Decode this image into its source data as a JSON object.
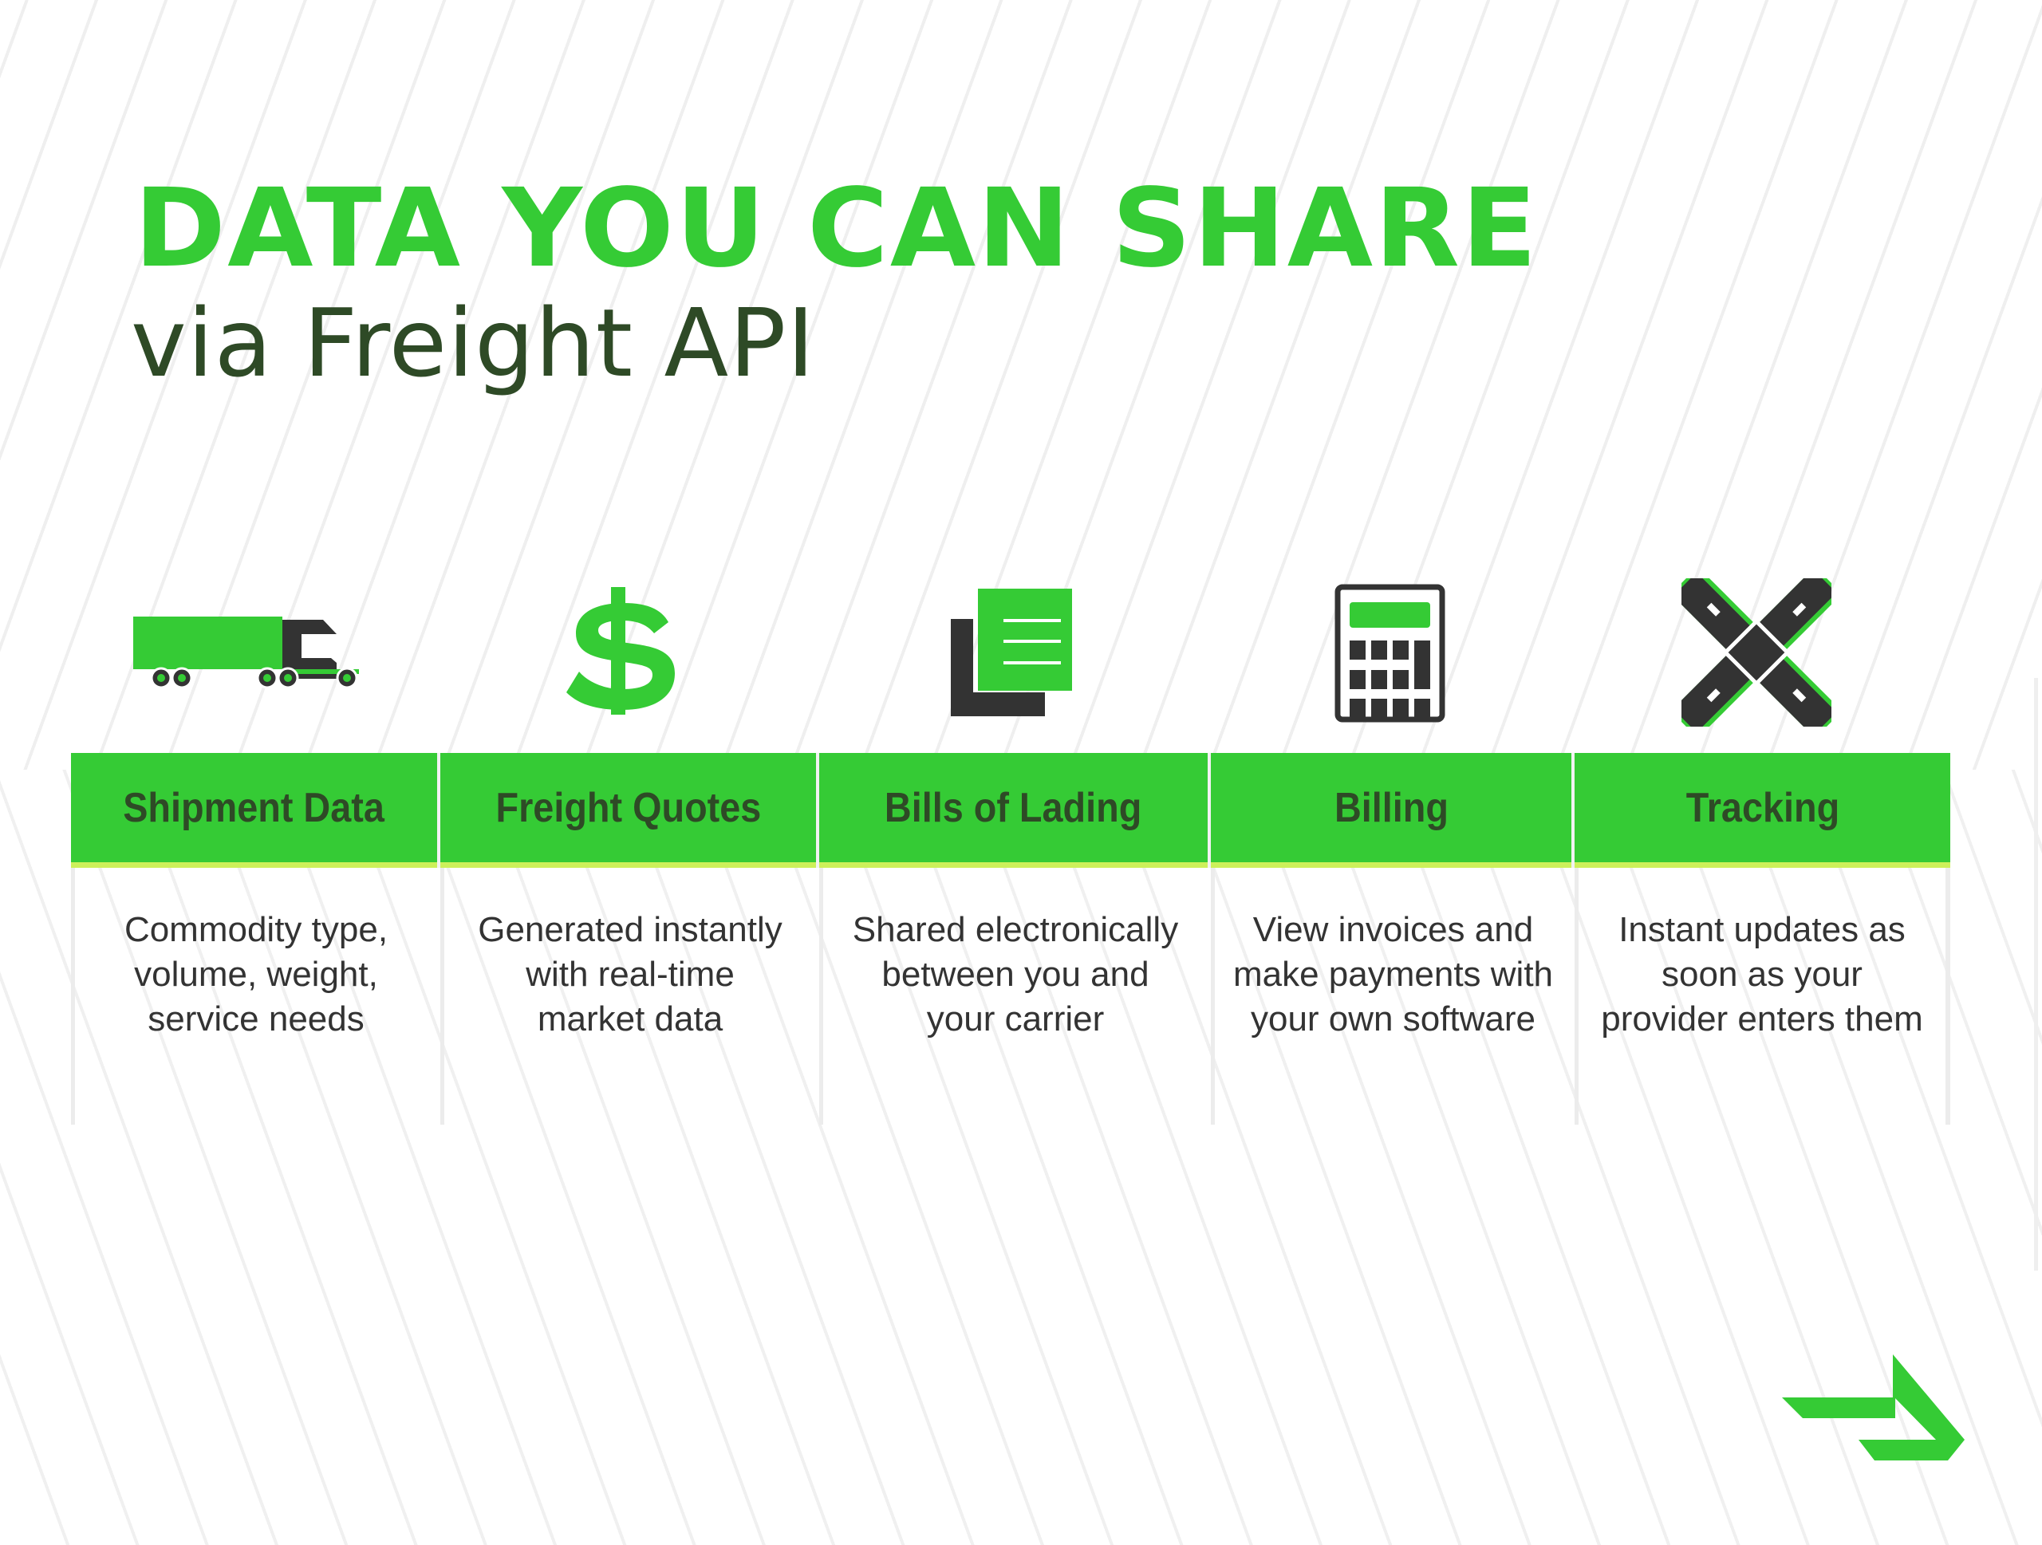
{
  "title": {
    "main": "DATA YOU CAN SHARE",
    "sub": "via Freight API"
  },
  "colors": {
    "brand_green": "#35cb35",
    "dark_green": "#2e4a26",
    "accent_lime": "#cdf05a",
    "dark_gray": "#333333"
  },
  "columns": [
    {
      "icon": "truck-icon",
      "label": "Shipment Data",
      "description": "Commodity type,\nvolume, weight,\nservice needs"
    },
    {
      "icon": "dollar-icon",
      "label": "Freight Quotes",
      "description": "Generated instantly\nwith real-time\nmarket data"
    },
    {
      "icon": "document-icon",
      "label": "Bills of Lading",
      "description": "Shared electronically\nbetween you and\nyour carrier"
    },
    {
      "icon": "calculator-icon",
      "label": "Billing",
      "description": "View invoices and\nmake payments with\nyour own software"
    },
    {
      "icon": "road-intersection-icon",
      "label": "Tracking",
      "description": "Instant updates as\nsoon as your\nprovider enters them"
    }
  ],
  "logo": {
    "icon": "arrow-logo-icon"
  }
}
